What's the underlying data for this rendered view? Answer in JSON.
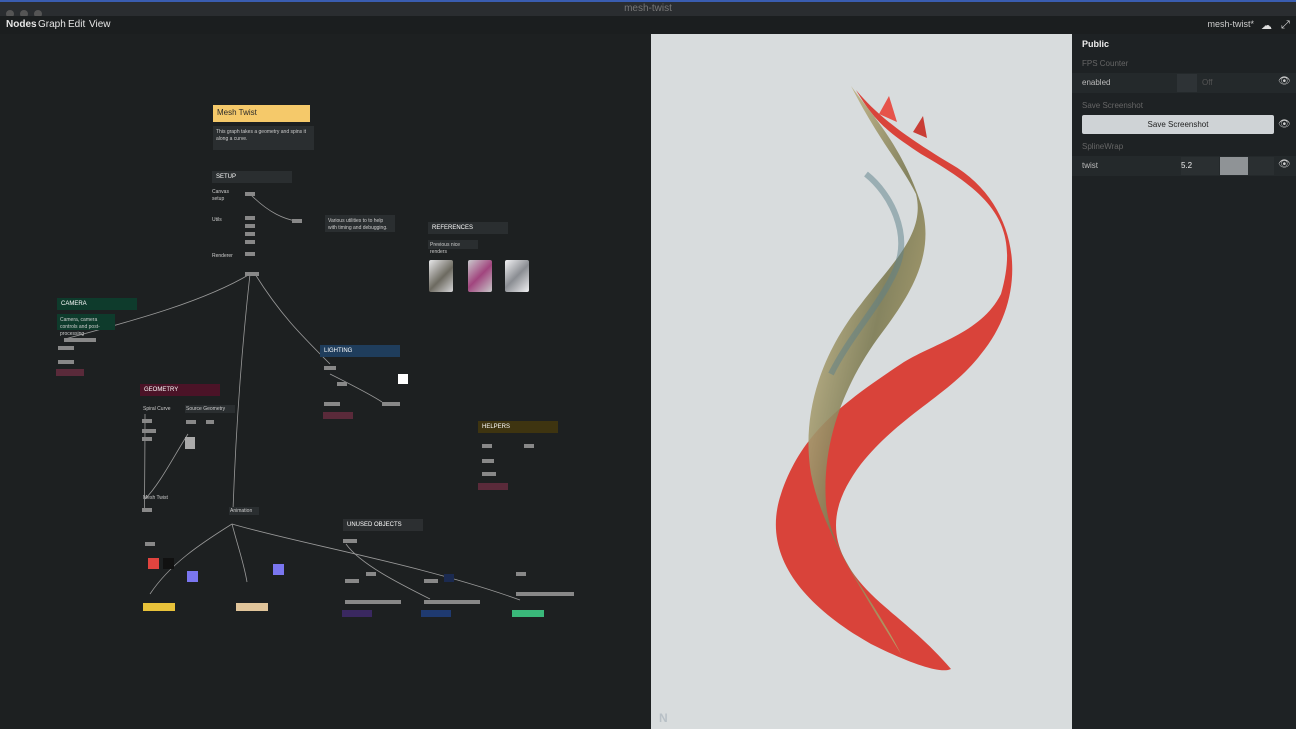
{
  "window": {
    "title": "mesh-twist"
  },
  "menubar": {
    "items": [
      "Nodes",
      "Graph",
      "Edit",
      "View"
    ],
    "doc_name": "mesh-twist*"
  },
  "graph": {
    "title_note": "Mesh Twist",
    "description": "This graph takes a geometry and spins it along a curve.",
    "groups": {
      "setup": "SETUP",
      "references": "REFERENCES",
      "camera": "CAMERA",
      "lighting": "LIGHTING",
      "geometry": "GEOMETRY",
      "helpers": "HELPERS",
      "unused": "UNUSED OBJECTS"
    },
    "notes": {
      "setup_utils": "Various utilities to to help with timing and debugging.",
      "references_note": "Previous nice renders",
      "camera_note": "Camera, camera controls and post-processing",
      "spiral_curve": "Spiral Curve",
      "source_geometry": "Source Geometry",
      "mesh_twist": "Mesh Twist",
      "animation": "Animation",
      "canvas_setup": "Canvas setup",
      "utils": "Utils",
      "renderer": "Renderer"
    }
  },
  "panel": {
    "heading": "Public",
    "fps_section": "FPS Counter",
    "fps_label": "enabled",
    "fps_value": "Off",
    "screenshot_section": "Save Screenshot",
    "screenshot_button": "Save Screenshot",
    "spline_section": "SplineWrap",
    "twist_label": "twist",
    "twist_value": "5.2",
    "twist_fill": 0.52
  },
  "icons": [
    "eye-icon",
    "cloud-icon",
    "fullscreen-icon"
  ],
  "colors": {
    "setup": "#2a2e30",
    "camera": "#0e3b2c",
    "lighting": "#1f3d5c",
    "geometry": "#4b1327",
    "helpers": "#3e3410",
    "unused": "#2c2f31",
    "title_note": "#f5c96a"
  }
}
